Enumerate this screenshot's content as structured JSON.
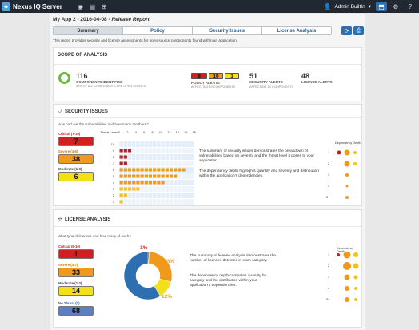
{
  "app": {
    "title": "Nexus IQ Server",
    "logo_icon": "nexus-logo-icon"
  },
  "topbar": {
    "user": "Admin BuiltIn",
    "caret": "▾"
  },
  "page": {
    "title_prefix": "My App 2 - 2016-04-08 - ",
    "title_suffix": "Release Report"
  },
  "tabs": [
    {
      "label": "Summary",
      "active": true
    },
    {
      "label": "Policy",
      "active": false
    },
    {
      "label": "Security Issues",
      "active": false
    },
    {
      "label": "License Analysis",
      "active": false
    }
  ],
  "description": "This report provides security and license assessments for open source components found within an application.",
  "scope": {
    "title": "SCOPE OF ANALYSIS",
    "components_count": "116",
    "components_label": "COMPONENTS IDENTIFIED",
    "components_sub": "95% OF ALL COMPONENTS ARE OPEN SOURCE",
    "policy_badges": [
      "8",
      "10",
      "1"
    ],
    "policy_label": "POLICY ALERTS",
    "policy_sub": "AFFECTING 10 COMPONENTS",
    "security_count": "51",
    "security_label": "SECURITY ALERTS",
    "security_sub": "AFFECTING 14 COMPONENTS",
    "license_count": "48",
    "license_label": "LICENSE ALERTS"
  },
  "security": {
    "title": "SECURITY ISSUES",
    "question": "How bad are the vulnerabilities and how many are there?",
    "severities": [
      {
        "label": "Critical (7-10)",
        "value": "7",
        "color": "#d31f1f"
      },
      {
        "label": "Severe (4-6)",
        "value": "38",
        "color": "#f09a1c"
      },
      {
        "label": "Moderate (1-3)",
        "value": "6",
        "color": "#f4e018"
      }
    ],
    "threat_level_label": "Threat Level",
    "count_ticks": [
      "0",
      "2",
      "4",
      "6",
      "8",
      "10",
      "12",
      "14",
      "16",
      "18"
    ],
    "threat_levels": [
      "10",
      "9",
      "8",
      "7",
      "6",
      "5",
      "4",
      "3",
      "2",
      "1"
    ],
    "bars": [
      0,
      3,
      2,
      2,
      16,
      14,
      11,
      5,
      2,
      1
    ],
    "paragraph1": "The summary of security issues demonstrates the breakdown of vulnerabilities based on severity and the threat level it poses to your application.",
    "paragraph2": "The dependency depth highlights quantity and severity and distribution within the application's dependencies.",
    "dependency_label": "Dependency Depth",
    "depth_rows": [
      "1",
      "2",
      "3",
      "4",
      "5+"
    ]
  },
  "license": {
    "title": "LICENSE ANALYSIS",
    "question": "What type of licenses and how many of each?",
    "severities": [
      {
        "label": "Critical (8-10)",
        "value": "1",
        "color": "#d31f1f"
      },
      {
        "label": "Severe (4-7)",
        "value": "33",
        "color": "#f09a1c"
      },
      {
        "label": "Moderate (1-3)",
        "value": "14",
        "color": "#f4e018"
      },
      {
        "label": "No Threat (0)",
        "value": "68",
        "color": "#5b7fc0"
      }
    ],
    "pct_critical": "1%",
    "pct_severe": "28%",
    "pct_moderate": "12%",
    "paragraph1": "The summary of license analysis demonstrates the number of licenses detected in each category.",
    "paragraph2": "The dependency depth compares quantity by category and the distribution within your application's dependencies.",
    "dependency_label": "Dependency Depth",
    "depth_rows": [
      "1",
      "2",
      "3",
      "4",
      "5+"
    ]
  },
  "chart_data": [
    {
      "type": "bar",
      "title": "",
      "xlabel": "",
      "ylabel": "Threat Level",
      "categories": [
        "10",
        "9",
        "8",
        "7",
        "6",
        "5",
        "4",
        "3",
        "2",
        "1"
      ],
      "values": [
        0,
        3,
        2,
        2,
        16,
        14,
        11,
        5,
        2,
        1
      ],
      "xlim": [
        0,
        18
      ]
    },
    {
      "type": "pie",
      "title": "",
      "categories": [
        "Critical (8-10)",
        "Severe (4-7)",
        "Moderate (1-3)",
        "No Threat (0)"
      ],
      "values": [
        1,
        33,
        14,
        68
      ],
      "colors": [
        "#d31f1f",
        "#f09a1c",
        "#f4e018",
        "#2d6fb1"
      ]
    }
  ]
}
